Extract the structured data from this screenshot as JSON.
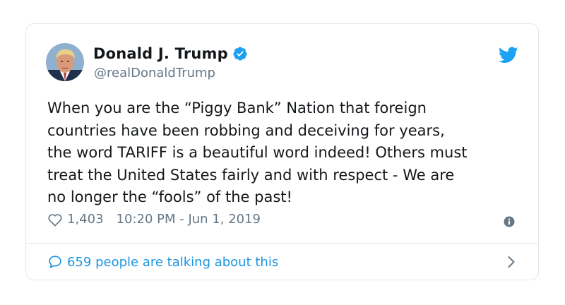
{
  "author": {
    "display_name": "Donald J. Trump",
    "handle": "@realDonaldTrump",
    "verified": true
  },
  "tweet": {
    "text": "When you are the “Piggy Bank” Nation that foreign\ncountries have been robbing and deceiving for years,\nthe word TARIFF is a beautiful word indeed! Others must\ntreat the United States fairly and with respect - We are\nno longer the “fools” of the past!",
    "likes": "1,403",
    "timestamp": "10:20 PM - Jun 1, 2019"
  },
  "footer": {
    "talking_text": "659 people are talking about this"
  },
  "icons": {
    "verified": "verified-badge-icon",
    "twitter": "twitter-bird-icon",
    "like": "heart-icon",
    "info": "info-icon",
    "reply": "speech-bubble-icon",
    "chevron": "chevron-right-icon"
  },
  "colors": {
    "brand_blue": "#1da1f2",
    "link_blue": "#1b95e0",
    "text_primary": "#14171a",
    "text_secondary": "#657786",
    "border": "#e1e8ed"
  }
}
